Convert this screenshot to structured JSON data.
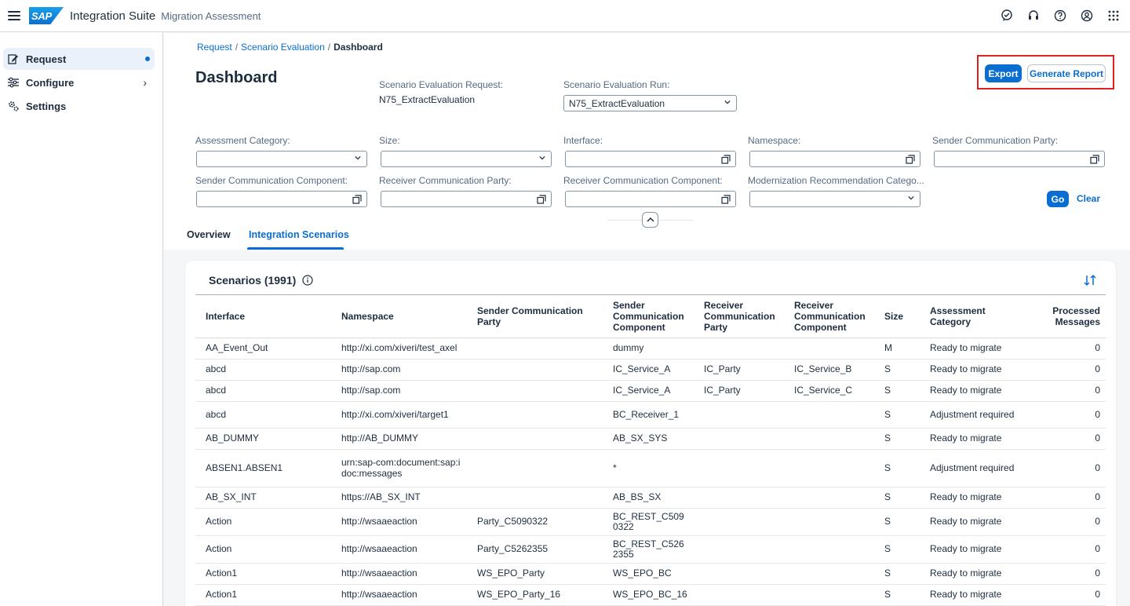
{
  "shell": {
    "logo_text": "SAP",
    "product": "Integration Suite",
    "subtitle": "Migration Assessment",
    "icons": [
      "feedback-icon",
      "support-icon",
      "help-icon",
      "user-profile-icon",
      "product-switch-icon"
    ]
  },
  "sidenav": {
    "items": [
      {
        "label": "Request",
        "icon": "request-icon"
      },
      {
        "label": "Configure",
        "icon": "configure-icon"
      },
      {
        "label": "Settings",
        "icon": "settings-icon"
      }
    ]
  },
  "header": {
    "breadcrumb": {
      "link1": "Request",
      "link2": "Scenario Evaluation",
      "sep": "/",
      "current": "Dashboard"
    },
    "title": "Dashboard",
    "request_label": "Scenario Evaluation Request:",
    "request_value": "N75_ExtractEvaluation",
    "run_label": "Scenario Evaluation Run:",
    "run_value": "N75_ExtractEvaluation",
    "export_label": "Export",
    "report_label": "Generate Report"
  },
  "filters": {
    "assessment_category": "Assessment Category:",
    "size": "Size:",
    "interface": "Interface:",
    "namespace": "Namespace:",
    "sender_party": "Sender Communication Party:",
    "sender_component": "Sender Communication Component:",
    "receiver_party": "Receiver Communication Party:",
    "receiver_component": "Receiver Communication Component:",
    "modernization": "Modernization Recommendation Catego...",
    "go_label": "Go",
    "clear_label": "Clear"
  },
  "tabs": {
    "overview": "Overview",
    "scenarios": "Integration Scenarios"
  },
  "table": {
    "title": "Scenarios (1991)",
    "headers": [
      "Interface",
      "Namespace",
      "Sender Communication Party",
      "Sender Communication Component",
      "Receiver Communication Party",
      "Receiver Communication Component",
      "Size",
      "Assessment Category",
      "Processed Messages"
    ],
    "rows": [
      [
        "AA_Event_Out",
        "http://xi.com/xiveri/test_axel",
        "",
        "dummy",
        "",
        "",
        "M",
        "Ready to migrate",
        "0"
      ],
      [
        "abcd",
        "http://sap.com",
        "",
        "IC_Service_A",
        "IC_Party",
        "IC_Service_B",
        "S",
        "Ready to migrate",
        "0"
      ],
      [
        "abcd",
        "http://sap.com",
        "",
        "IC_Service_A",
        "IC_Party",
        "IC_Service_C",
        "S",
        "Ready to migrate",
        "0"
      ],
      [
        "abcd",
        "http://xi.com/xiveri/target1",
        "",
        "BC_Receiver_1",
        "",
        "",
        "S",
        "Adjustment required",
        "0"
      ],
      [
        "AB_DUMMY",
        "http://AB_DUMMY",
        "",
        "AB_SX_SYS",
        "",
        "",
        "S",
        "Ready to migrate",
        "0"
      ],
      [
        "ABSEN1.ABSEN1",
        "urn:sap-com:document:sap:idoc:messages",
        "",
        "*",
        "",
        "",
        "S",
        "Adjustment required",
        "0"
      ],
      [
        "AB_SX_INT",
        "https://AB_SX_INT",
        "",
        "AB_BS_SX",
        "",
        "",
        "S",
        "Ready to migrate",
        "0"
      ],
      [
        "Action",
        "http://wsaaeaction",
        "Party_C5090322",
        "BC_REST_C5090322",
        "",
        "",
        "S",
        "Ready to migrate",
        "0"
      ],
      [
        "Action",
        "http://wsaaeaction",
        "Party_C5262355",
        "BC_REST_C5262355",
        "",
        "",
        "S",
        "Ready to migrate",
        "0"
      ],
      [
        "Action1",
        "http://wsaaeaction",
        "WS_EPO_Party",
        "WS_EPO_BC",
        "",
        "",
        "S",
        "Ready to migrate",
        "0"
      ],
      [
        "Action1",
        "http://wsaaeaction",
        "WS_EPO_Party_16",
        "WS_EPO_BC_16",
        "",
        "",
        "S",
        "Ready to migrate",
        "0"
      ]
    ]
  },
  "colors": {
    "accent": "#0a6ed1",
    "highlight": "#e02020",
    "text": "#1d2d3e",
    "muted": "#556b82"
  }
}
